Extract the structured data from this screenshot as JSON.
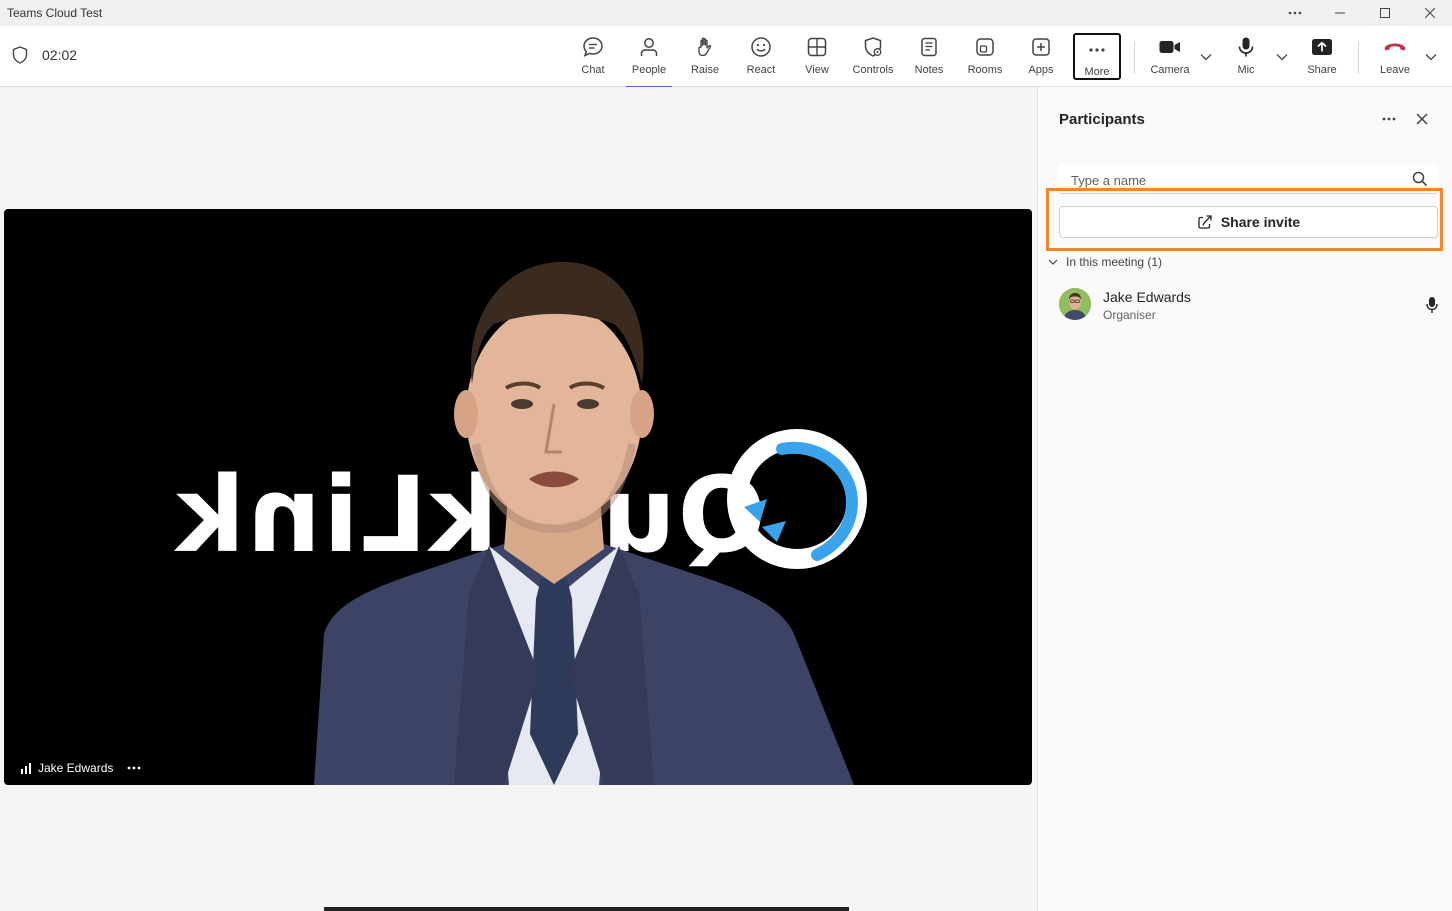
{
  "window": {
    "title": "Teams Cloud Test"
  },
  "meeting": {
    "timer": "02:02"
  },
  "toolbar": {
    "chat": "Chat",
    "people": "People",
    "raise": "Raise",
    "react": "React",
    "view": "View",
    "controls": "Controls",
    "notes": "Notes",
    "rooms": "Rooms",
    "apps": "Apps",
    "more": "More",
    "camera": "Camera",
    "mic": "Mic",
    "share": "Share",
    "leave": "Leave"
  },
  "video": {
    "participant_name": "Jake Edwards",
    "logo_text": "QuickLink"
  },
  "panel": {
    "title": "Participants",
    "search_placeholder": "Type a name",
    "share_invite": "Share invite",
    "section_label": "In this meeting (1)",
    "participants": [
      {
        "name": "Jake Edwards",
        "role": "Organiser"
      }
    ]
  },
  "colors": {
    "accent": "#5b5fc7",
    "leave": "#c4314b",
    "highlight": "#f7832d",
    "video_bg": "#000000"
  }
}
